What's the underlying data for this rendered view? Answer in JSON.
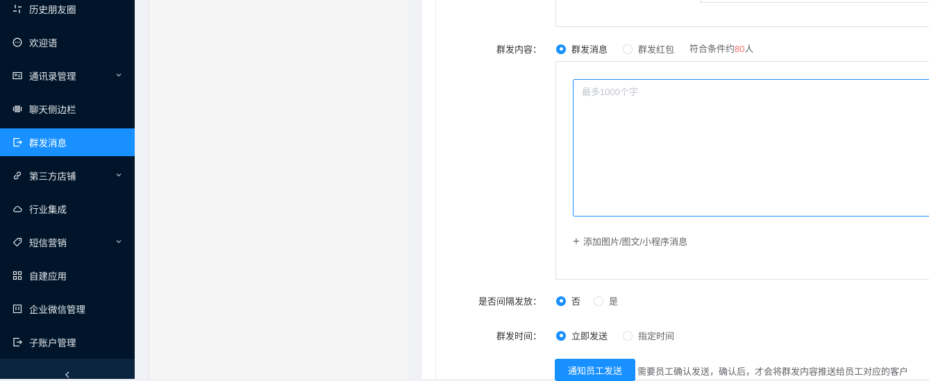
{
  "sidebar": {
    "items": [
      {
        "label": "历史朋友圈",
        "icon": "moments-icon",
        "has_submenu": false,
        "active": false
      },
      {
        "label": "欢迎语",
        "icon": "chat-bubble-icon",
        "has_submenu": false,
        "active": false
      },
      {
        "label": "通讯录管理",
        "icon": "contact-card-icon",
        "has_submenu": true,
        "active": false
      },
      {
        "label": "聊天侧边栏",
        "icon": "sidebar-bars-icon",
        "has_submenu": false,
        "active": false
      },
      {
        "label": "群发消息",
        "icon": "export-icon",
        "has_submenu": false,
        "active": true
      },
      {
        "label": "第三方店铺",
        "icon": "link-icon",
        "has_submenu": true,
        "active": false
      },
      {
        "label": "行业集成",
        "icon": "cloud-icon",
        "has_submenu": false,
        "active": false
      },
      {
        "label": "短信营销",
        "icon": "tag-icon",
        "has_submenu": true,
        "active": false
      },
      {
        "label": "自建应用",
        "icon": "grid-icon",
        "has_submenu": false,
        "active": false
      },
      {
        "label": "企业微信管理",
        "icon": "building-icon",
        "has_submenu": false,
        "active": false
      },
      {
        "label": "子账户管理",
        "icon": "export-icon",
        "has_submenu": false,
        "active": false
      }
    ],
    "collapse_icon": "chevron-left-icon"
  },
  "form": {
    "content": {
      "label": "群发内容：",
      "options": [
        "群发消息",
        "群发红包"
      ],
      "selected": "群发消息",
      "eligible_prefix": "符合条件约",
      "eligible_count": "80",
      "eligible_suffix": "人",
      "textarea_placeholder": "最多1000个字",
      "add_label": "添加图片/图文/小程序消息"
    },
    "interval": {
      "label": "是否间隔发放：",
      "options": [
        "否",
        "是"
      ],
      "selected": "否"
    },
    "time": {
      "label": "群发时间：",
      "options": [
        "立即发送",
        "指定时间"
      ],
      "selected": "立即发送"
    },
    "notify_button": "通知员工发送",
    "notify_hint": "需要员工确认发送，确认后，才会将群发内容推送给员工对应的客户"
  },
  "colors": {
    "sidebar_bg": "#001529",
    "active": "#1890ff",
    "count_red": "#f56c6c"
  }
}
